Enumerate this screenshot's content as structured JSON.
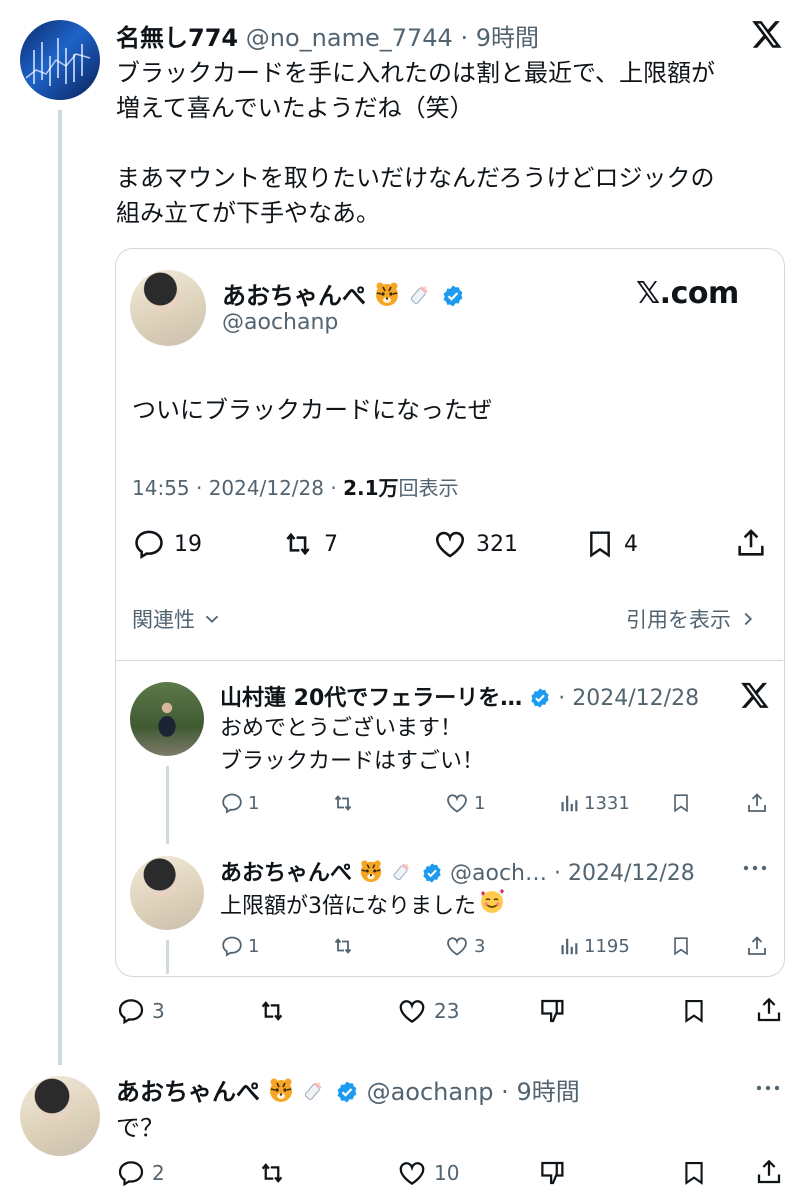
{
  "main_tweet": {
    "name": "名無し774",
    "handle": "@no_name_7744",
    "time": "9時間",
    "text_line1": "ブラックカードを手に入れたのは割と最近で、上限額が",
    "text_line2": "増えて喜んでいたようだね（笑）",
    "text_line3": "まあマウントを取りたいだけなんだろうけどロジックの",
    "text_line4": "組み立てが下手やなあ。",
    "actions": {
      "replies": "3",
      "likes": "23"
    }
  },
  "embed": {
    "name": "あおちゃんぺ",
    "handle": "@aochanp",
    "brand": "𝕏.com",
    "text": "ついにブラックカードになったぜ",
    "meta_time": "14:55 · 2024/12/28 · ",
    "meta_views_bold": "2.1万",
    "meta_views_suffix": "回表示",
    "stats": {
      "replies": "19",
      "retweets": "7",
      "likes": "321",
      "bookmarks": "4"
    },
    "related_label": "関連性",
    "quote_label": "引用を表示"
  },
  "replies": [
    {
      "name": "山村蓮 20代でフェラーリを…",
      "meta": "· 2024/12/28",
      "line1": "おめでとうございます！",
      "line2": "ブラックカードはすごい！",
      "reply_count": "1",
      "like_count": "1",
      "views": "1331"
    },
    {
      "name": "あおちゃんぺ",
      "handle": "@aoch…",
      "meta": "· 2024/12/28",
      "line1": "上限額が3倍になりました",
      "reply_count": "1",
      "like_count": "3",
      "views": "1195"
    }
  ],
  "bottom_tweet": {
    "name": "あおちゃんぺ",
    "handle": "@aochanp",
    "time": "9時間",
    "text": "で？",
    "actions": {
      "replies": "2",
      "likes": "10"
    }
  },
  "colors": {
    "accent": "#1d9bf0",
    "text": "#0f1419",
    "muted": "#536471",
    "border": "#cfd9de"
  }
}
